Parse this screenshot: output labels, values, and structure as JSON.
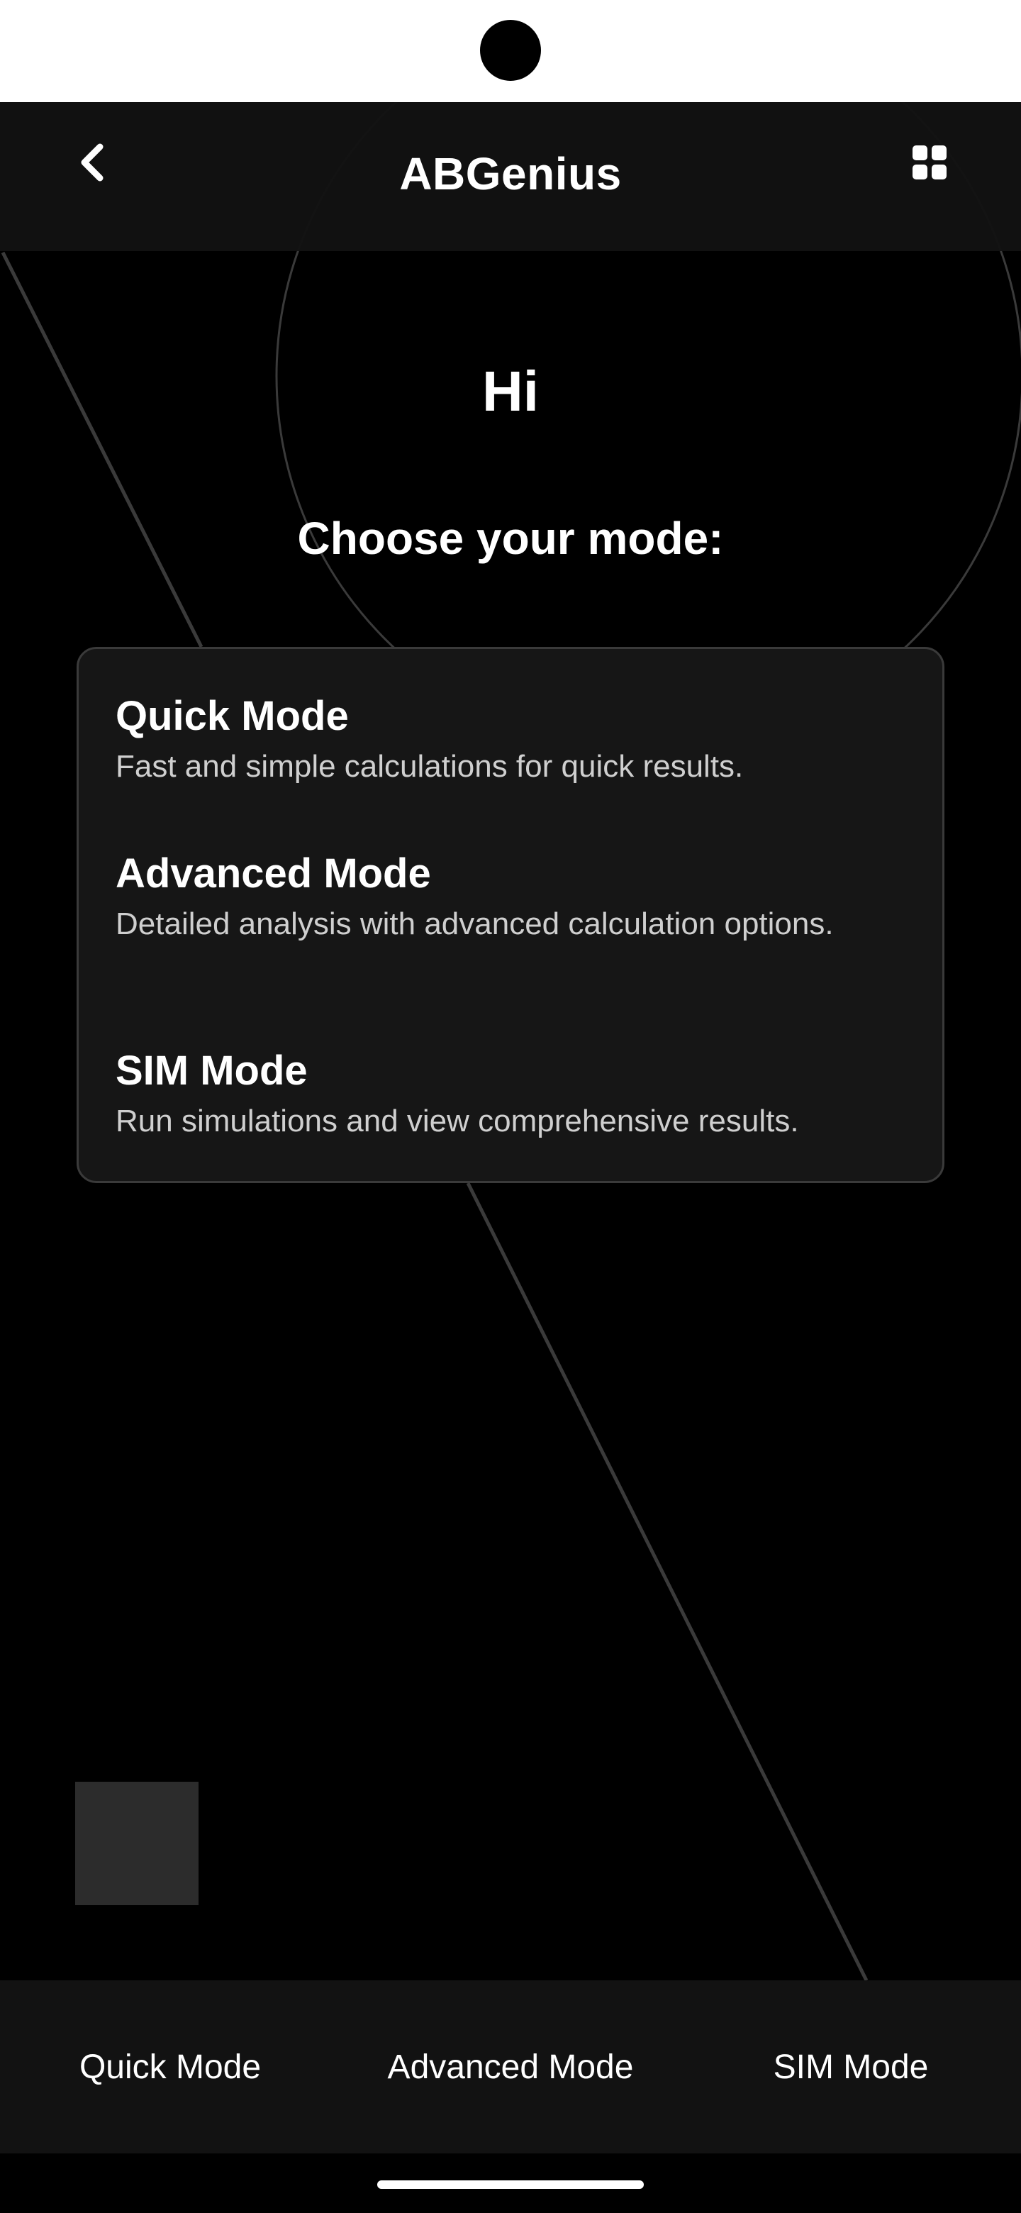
{
  "app_bar": {
    "title": "ABGenius",
    "back_icon": "chevron-left-icon",
    "menu_icon": "grid-icon"
  },
  "main": {
    "greeting": "Hi",
    "prompt": "Choose your mode:",
    "modes": [
      {
        "title": "Quick Mode",
        "description": "Fast and simple calculations for quick results."
      },
      {
        "title": "Advanced Mode",
        "description": "Detailed analysis with advanced calculation options."
      },
      {
        "title": "SIM Mode",
        "description": "Run simulations and view comprehensive results."
      }
    ]
  },
  "bottom_nav": {
    "items": [
      {
        "label": "Quick Mode"
      },
      {
        "label": "Advanced Mode"
      },
      {
        "label": "SIM Mode"
      }
    ]
  },
  "colors": {
    "background": "#000000",
    "surface": "#161616",
    "app_bar": "#121212",
    "text_primary": "#ffffff",
    "text_secondary": "#cfcfcf",
    "outline": "#3a3a3a"
  }
}
